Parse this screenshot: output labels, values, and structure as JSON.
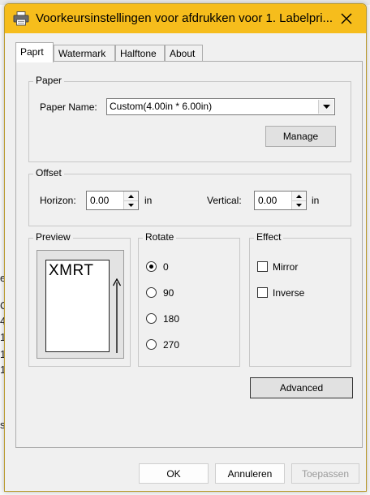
{
  "window": {
    "title": "Voorkeursinstellingen voor afdrukken voor 1. Labelpri...",
    "title_bar_color": "#f6bd1c",
    "icons": {
      "app": "printer-icon",
      "close": "close-icon"
    }
  },
  "tabs": [
    {
      "label": "Paprt",
      "active": true
    },
    {
      "label": "Watermark",
      "active": false
    },
    {
      "label": "Halftone",
      "active": false
    },
    {
      "label": "About",
      "active": false
    }
  ],
  "paper": {
    "group_label": "Paper",
    "name_label": "Paper Name:",
    "name_value": "Custom(4.00in * 6.00in)",
    "manage_label": "Manage"
  },
  "offset": {
    "group_label": "Offset",
    "horizon_label": "Horizon:",
    "horizon_value": "0.00",
    "horizon_unit": "in",
    "vertical_label": "Vertical:",
    "vertical_value": "0.00",
    "vertical_unit": "in"
  },
  "preview": {
    "group_label": "Preview",
    "sample_text": "XMRT"
  },
  "rotate": {
    "group_label": "Rotate",
    "options": [
      "0",
      "90",
      "180",
      "270"
    ],
    "selected": "0"
  },
  "effect": {
    "group_label": "Effect",
    "mirror_label": "Mirror",
    "mirror_checked": false,
    "inverse_label": "Inverse",
    "inverse_checked": false
  },
  "advanced_label": "Advanced",
  "footer": {
    "ok": "OK",
    "cancel": "Annuleren",
    "apply": "Toepassen",
    "apply_enabled": false
  },
  "background_fragments": [
    "e",
    "C",
    "4",
    "1",
    "1",
    "1",
    "s"
  ]
}
